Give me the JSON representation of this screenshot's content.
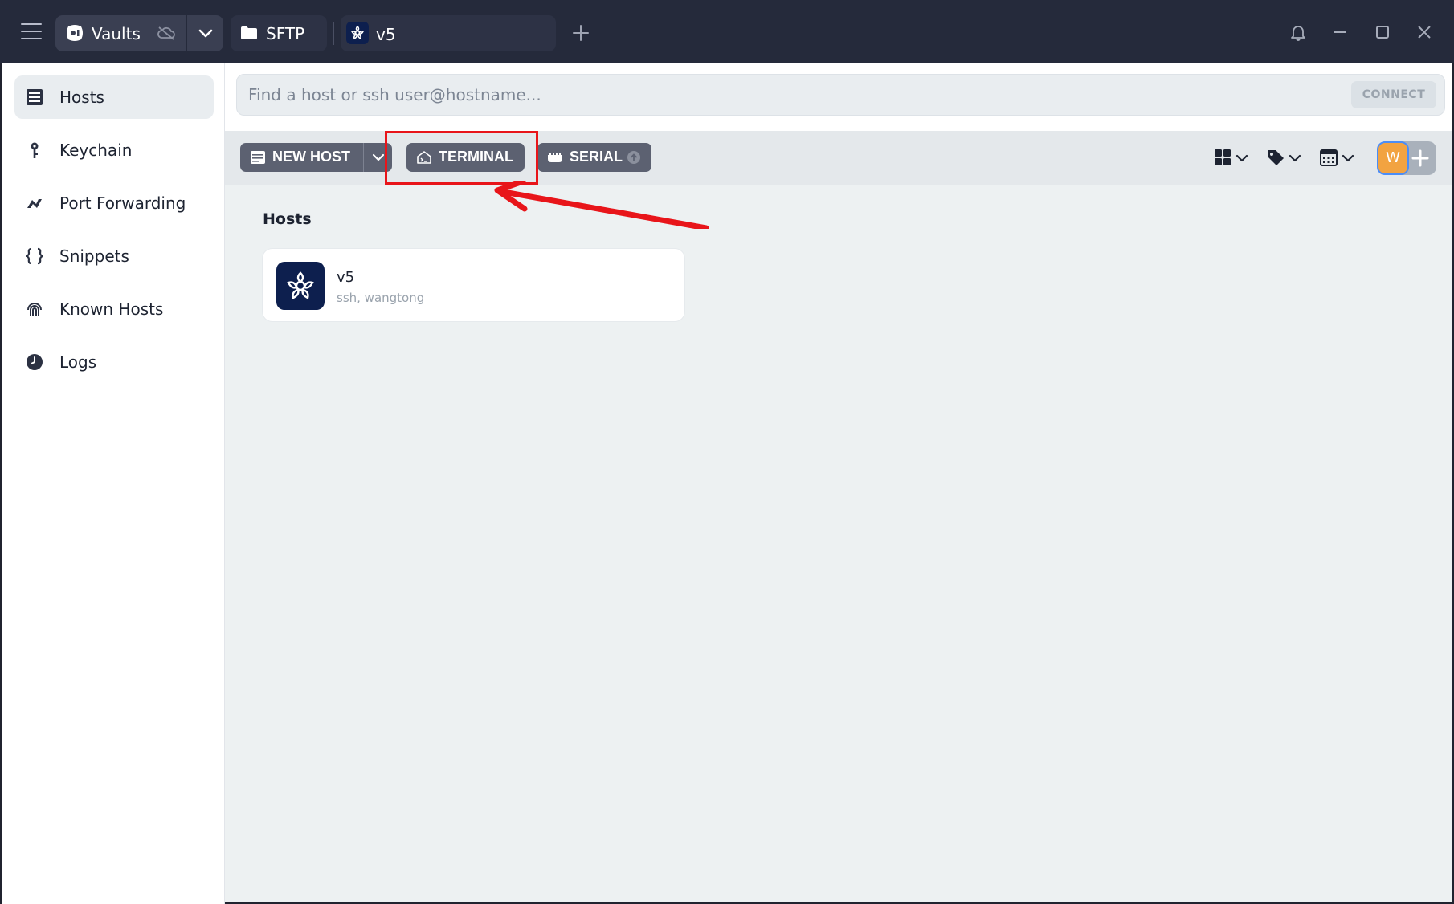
{
  "titlebar": {
    "vaults_label": "Vaults",
    "sftp_label": "SFTP",
    "session_tab_label": "v5"
  },
  "sidebar": {
    "items": [
      {
        "label": "Hosts",
        "icon": "hosts-grid-icon",
        "active": true
      },
      {
        "label": "Keychain",
        "icon": "key-icon",
        "active": false
      },
      {
        "label": "Port Forwarding",
        "icon": "port-forwarding-icon",
        "active": false
      },
      {
        "label": "Snippets",
        "icon": "curly-braces-icon",
        "active": false
      },
      {
        "label": "Known Hosts",
        "icon": "fingerprint-icon",
        "active": false
      },
      {
        "label": "Logs",
        "icon": "clock-icon",
        "active": false
      }
    ]
  },
  "search": {
    "placeholder": "Find a host or ssh user@hostname...",
    "connect_label": "CONNECT"
  },
  "toolbar": {
    "new_host_label": "NEW HOST",
    "terminal_label": "TERMINAL",
    "serial_label": "SERIAL",
    "avatar_initial": "W"
  },
  "hosts_section": {
    "title": "Hosts",
    "items": [
      {
        "name": "v5",
        "subtitle": "ssh, wangtong"
      }
    ]
  },
  "colors": {
    "titlebar": "#252a3b",
    "toolbar_button": "#5c6171",
    "host_icon_bg": "#0d1f4e",
    "avatar": "#f2a341",
    "annotation_red": "#e8151a"
  }
}
